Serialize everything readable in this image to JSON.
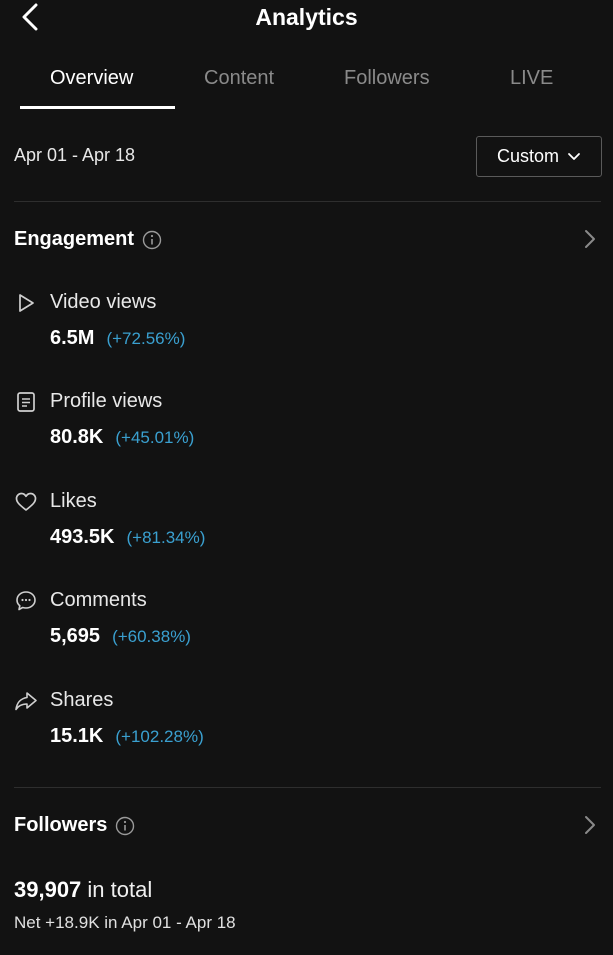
{
  "header": {
    "title": "Analytics"
  },
  "tabs": [
    {
      "label": "Overview",
      "active": true
    },
    {
      "label": "Content",
      "active": false
    },
    {
      "label": "Followers",
      "active": false
    },
    {
      "label": "LIVE",
      "active": false
    }
  ],
  "date_range": "Apr 01 - Apr 18",
  "range_button": "Custom",
  "engagement": {
    "title": "Engagement",
    "metrics": [
      {
        "label": "Video views",
        "value": "6.5M",
        "change": "(+72.56%)",
        "icon": "play-icon"
      },
      {
        "label": "Profile views",
        "value": "80.8K",
        "change": "(+45.01%)",
        "icon": "profile-card-icon"
      },
      {
        "label": "Likes",
        "value": "493.5K",
        "change": "(+81.34%)",
        "icon": "heart-icon"
      },
      {
        "label": "Comments",
        "value": "5,695",
        "change": "(+60.38%)",
        "icon": "comment-icon"
      },
      {
        "label": "Shares",
        "value": "15.1K",
        "change": "(+102.28%)",
        "icon": "share-icon"
      }
    ]
  },
  "followers": {
    "title": "Followers",
    "total": "39,907",
    "total_suffix": "in total",
    "net": "Net +18.9K in Apr 01 - Apr 18"
  },
  "colors": {
    "background": "#121212",
    "accent_change": "#3aa0d0",
    "muted_tab": "#8a8a8a"
  }
}
